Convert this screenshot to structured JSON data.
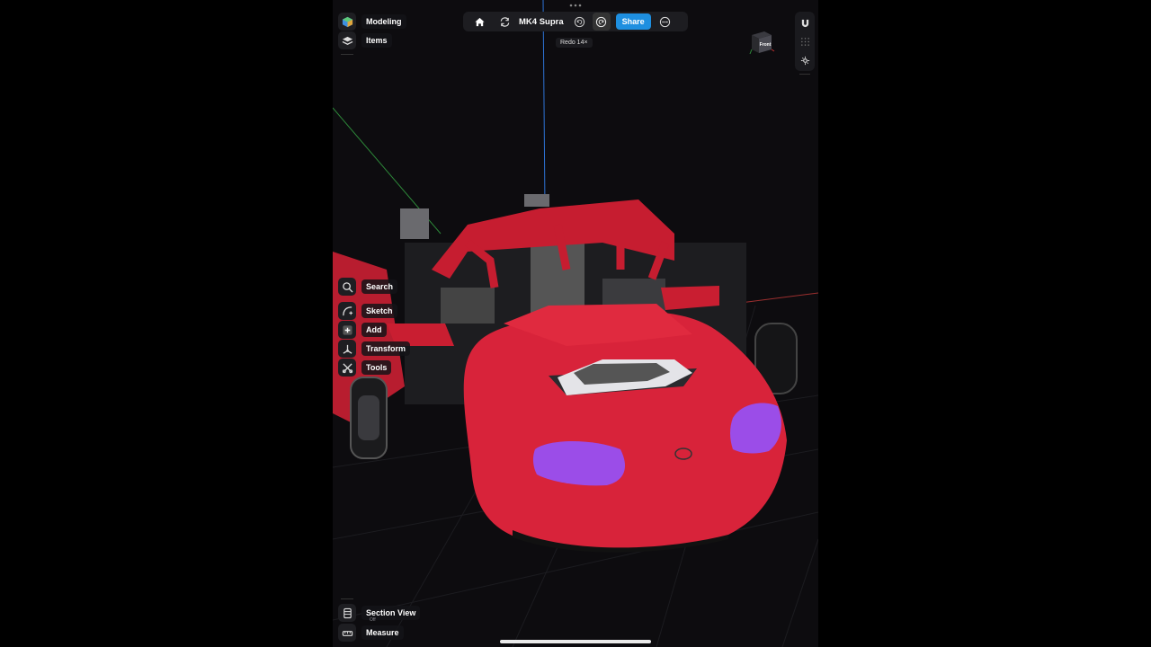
{
  "document": {
    "title": "MK4 Supra"
  },
  "toolbar": {
    "share_label": "Share",
    "redo_tooltip": "Redo 14×"
  },
  "left_top": [
    {
      "key": "modeling",
      "label": "Modeling",
      "icon": "modeling-cube-icon"
    },
    {
      "key": "items",
      "label": "Items",
      "icon": "layers-icon"
    }
  ],
  "left_tools": [
    {
      "key": "search",
      "label": "Search",
      "icon": "search-icon"
    },
    {
      "key": "sketch",
      "label": "Sketch",
      "icon": "sketch-icon"
    },
    {
      "key": "add",
      "label": "Add",
      "icon": "add-icon"
    },
    {
      "key": "transform",
      "label": "Transform",
      "icon": "transform-icon"
    },
    {
      "key": "tools",
      "label": "Tools",
      "icon": "tools-icon"
    }
  ],
  "left_bottom": [
    {
      "key": "section_view",
      "label": "Section View",
      "sub": "Off",
      "icon": "section-view-icon"
    },
    {
      "key": "measure",
      "label": "Measure",
      "icon": "measure-icon"
    }
  ],
  "view_cube": {
    "face": "Front"
  },
  "colors": {
    "accent": "#1e8fe0",
    "car_body": "#d8233a",
    "headlight": "#9b4de8",
    "background": "#0d0c0f"
  }
}
